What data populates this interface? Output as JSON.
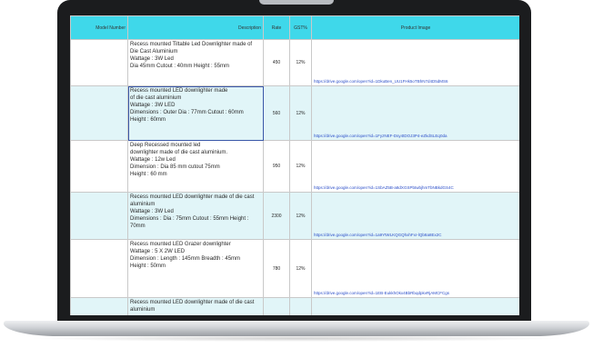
{
  "table": {
    "headers": {
      "model": "Model Number",
      "description": "Description",
      "rate": "Rate",
      "gst": "GST%",
      "image": "Product Image"
    },
    "rows": [
      {
        "desc": [
          "Recess mounted Tiltable Led Downlighter made of",
          "Die Cast Aluminium",
          "Wattage : 3W Led",
          "Dia 45mm Cutout : 40mm Height : 55mm"
        ],
        "rate": "450",
        "gst": "12%",
        "link": "https://drive.google.com/open?id=1DkuBen_UU1FHk5oTBhN7d4D5dMS6",
        "selected": false
      },
      {
        "desc": [
          "Recess mounted LED downlighter made",
          "of die cast aluminium",
          "Wattage : 3W LED",
          "Dimensions : Outer Dia : 77mm Cutout : 60mm",
          "Height : 60mm"
        ],
        "rate": "560",
        "gst": "12%",
        "link": "https://drive.google.com/open?id=1FyzNEF-Dsy4tDOJ3P4-eZkdSLEq0da",
        "selected": true
      },
      {
        "desc": [
          "Deep Recessed mounted led",
          "downlighter made of die cast aluminium.",
          "Wattage : 12w Led",
          "Dimension : Dia 85 mm cutout 75mm",
          "Height : 60 mm"
        ],
        "rate": "950",
        "gst": "12%",
        "link": "https://drive.google.com/open?id=1SbAZ5B-a8dXGSPbtwbjhmTbNBkdGS4C",
        "selected": false
      },
      {
        "desc": [
          "Recess mounted LED downlighter made of die cast",
          "aluminium",
          "Wattage : 3W Led",
          "Dimensions : Dia : 75mm Cutout : 55mm Height :",
          "70mm"
        ],
        "rate": "2300",
        "gst": "12%",
        "link": "https://drive.google.com/open?id=1a9YtWLKQGQhxhFxr-lQb8a8Ex2C",
        "selected": false
      },
      {
        "desc": [
          "Recess mounted LED Grazer downlighter",
          "Wattage : 5 X 2W LED",
          "Dimension : Length : 145mm Breadth : 45mm",
          "Height : 50mm"
        ],
        "rate": "780",
        "gst": "12%",
        "link": "https://drive.google.com/open?id=1EB-EukkhOkx4BbRbqdpkvRjAMCFCgs",
        "selected": false
      },
      {
        "desc": [
          "Recess mounted LED downlighter made of die cast",
          "aluminium"
        ],
        "rate": "",
        "gst": "",
        "link": "",
        "selected": false
      }
    ]
  }
}
